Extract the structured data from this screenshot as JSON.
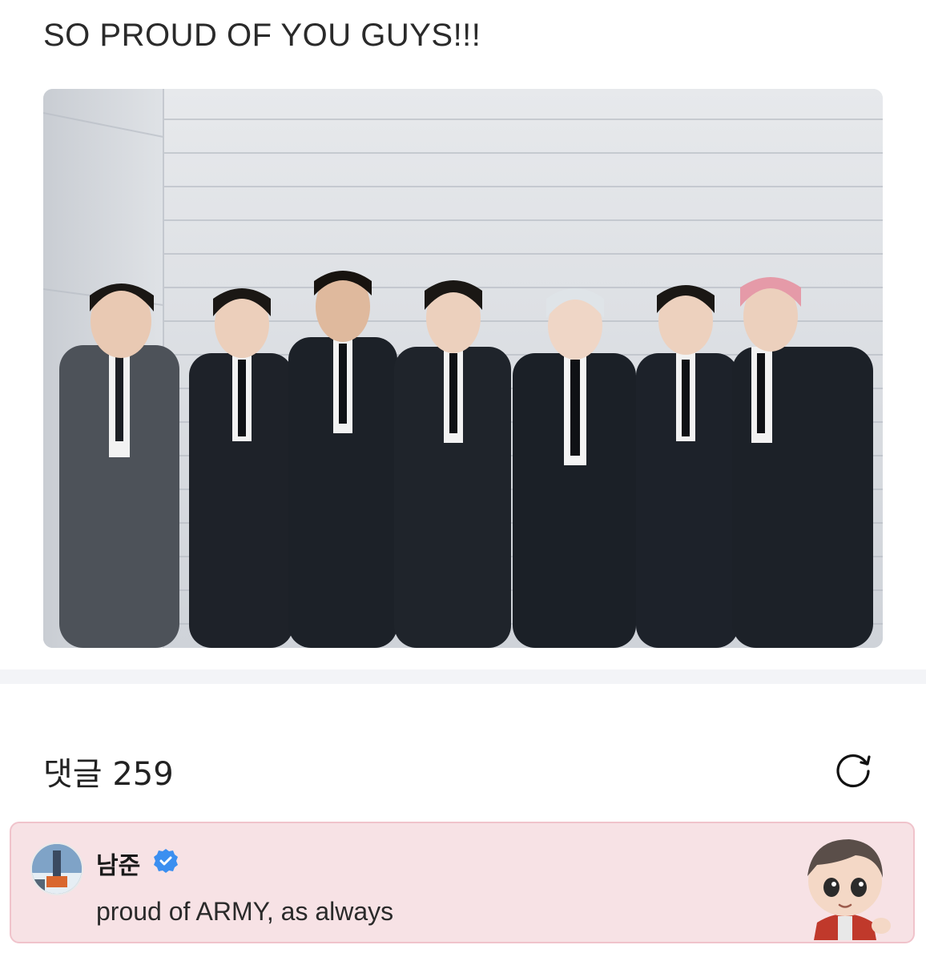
{
  "post": {
    "text": "SO PROUD OF YOU GUYS!!!",
    "photo_alt": "group-photo"
  },
  "comments": {
    "label": "댓글",
    "count": "259",
    "refresh_icon": "refresh-icon"
  },
  "highlighted_comment": {
    "author": "남준",
    "verified_icon": "verified-badge-icon",
    "body": "proud of ARMY, as always",
    "avatar_icon": "avatar",
    "sticker_icon": "character-sticker"
  },
  "colors": {
    "card_bg": "#f7e2e5",
    "card_border": "#f0c3cb",
    "verified": "#3b8ff0",
    "divider": "#f3f4f7"
  }
}
